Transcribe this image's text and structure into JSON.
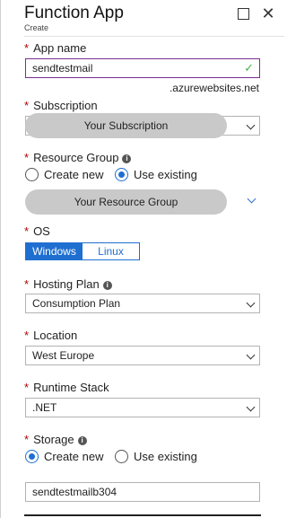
{
  "header": {
    "title": "Function App",
    "subtitle": "Create"
  },
  "required_mark": "*",
  "app_name": {
    "label": "App name",
    "value": "sendtestmail",
    "suffix": ".azurewebsites.net"
  },
  "subscription": {
    "label": "Subscription",
    "value": "Your Subscription"
  },
  "resource_group": {
    "label": "Resource Group",
    "options": [
      "Create new",
      "Use existing"
    ],
    "selected": "Use existing",
    "value": "Your Resource Group"
  },
  "os": {
    "label": "OS",
    "options": [
      "Windows",
      "Linux"
    ],
    "selected": "Windows"
  },
  "hosting_plan": {
    "label": "Hosting Plan",
    "value": "Consumption Plan"
  },
  "location": {
    "label": "Location",
    "value": "West Europe"
  },
  "runtime_stack": {
    "label": "Runtime Stack",
    "value": ".NET"
  },
  "storage": {
    "label": "Storage",
    "options": [
      "Create new",
      "Use existing"
    ],
    "selected": "Create new",
    "value": "sendtestmailb304"
  },
  "icons": {
    "maximize": "maximize-icon",
    "close": "close-icon",
    "info": "info-icon",
    "check": "checkmark-icon",
    "dropdown": "chevron-down-icon"
  },
  "colors": {
    "accent": "#1f6fd0",
    "valid_border": "#7b2f8f",
    "valid_check": "#4caf50",
    "required": "#b10000"
  }
}
